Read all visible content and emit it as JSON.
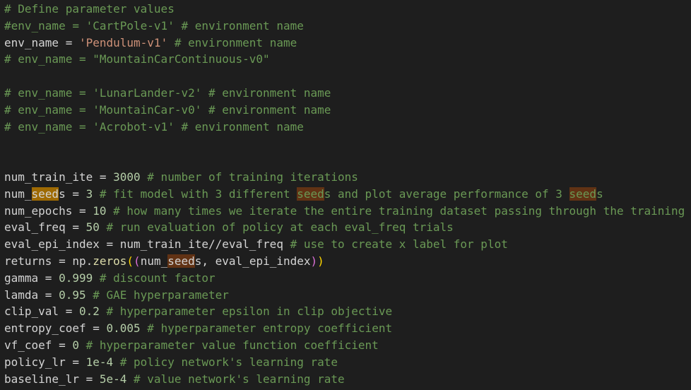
{
  "editor": {
    "lines": [
      [
        {
          "t": "# Define parameter values",
          "c": "comment"
        }
      ],
      [
        {
          "t": "#env_name = 'CartPole-v1' # environment name",
          "c": "comment"
        }
      ],
      [
        {
          "t": "env_name = ",
          "c": "plain"
        },
        {
          "t": "'Pendulum-v1'",
          "c": "string"
        },
        {
          "t": " # environment name",
          "c": "comment"
        }
      ],
      [
        {
          "t": "# env_name = \"MountainCarContinuous-v0\"",
          "c": "comment"
        }
      ],
      [],
      [
        {
          "t": "# env_name = 'LunarLander-v2' # environment name",
          "c": "comment"
        }
      ],
      [
        {
          "t": "# env_name = 'MountainCar-v0' # environment name",
          "c": "comment"
        }
      ],
      [
        {
          "t": "# env_name = 'Acrobot-v1' # environment name",
          "c": "comment"
        }
      ],
      [],
      [],
      [
        {
          "t": "num_train_ite = ",
          "c": "plain"
        },
        {
          "t": "3000",
          "c": "number"
        },
        {
          "t": " # number of training iterations",
          "c": "comment"
        }
      ],
      [
        {
          "t": "num_",
          "c": "plain"
        },
        {
          "t": "seed",
          "c": "plain",
          "h": "main"
        },
        {
          "t": "s = ",
          "c": "plain"
        },
        {
          "t": "3",
          "c": "number"
        },
        {
          "t": " # fit model with 3 different ",
          "c": "comment"
        },
        {
          "t": "seed",
          "c": "comment",
          "h": "other"
        },
        {
          "t": "s and plot average performance of 3 ",
          "c": "comment"
        },
        {
          "t": "seed",
          "c": "comment",
          "h": "other"
        },
        {
          "t": "s",
          "c": "comment"
        }
      ],
      [
        {
          "t": "num_epochs = ",
          "c": "plain"
        },
        {
          "t": "10",
          "c": "number"
        },
        {
          "t": " # how many times we iterate the entire training dataset passing through the training",
          "c": "comment"
        }
      ],
      [
        {
          "t": "eval_freq = ",
          "c": "plain"
        },
        {
          "t": "50",
          "c": "number"
        },
        {
          "t": " # run evaluation of policy at each eval_freq trials",
          "c": "comment"
        }
      ],
      [
        {
          "t": "eval_epi_index = num_train_ite//eval_freq",
          "c": "plain"
        },
        {
          "t": " # use to create x label for plot",
          "c": "comment"
        }
      ],
      [
        {
          "t": "returns = np.",
          "c": "plain"
        },
        {
          "t": "zeros",
          "c": "yellow"
        },
        {
          "t": "(",
          "c": "br1"
        },
        {
          "t": "(",
          "c": "br2"
        },
        {
          "t": "num_",
          "c": "plain"
        },
        {
          "t": "seed",
          "c": "plain",
          "h": "other"
        },
        {
          "t": "s, eval_epi_index",
          "c": "plain"
        },
        {
          "t": ")",
          "c": "br2"
        },
        {
          "t": ")",
          "c": "br1"
        }
      ],
      [
        {
          "t": "gamma = ",
          "c": "plain"
        },
        {
          "t": "0.999",
          "c": "number"
        },
        {
          "t": " # discount factor",
          "c": "comment"
        }
      ],
      [
        {
          "t": "lamda = ",
          "c": "plain"
        },
        {
          "t": "0.95",
          "c": "number"
        },
        {
          "t": " # GAE hyperparameter",
          "c": "comment"
        }
      ],
      [
        {
          "t": "clip_val = ",
          "c": "plain"
        },
        {
          "t": "0.2",
          "c": "number"
        },
        {
          "t": " # hyperparameter epsilon in clip objective",
          "c": "comment"
        }
      ],
      [
        {
          "t": "entropy_coef = ",
          "c": "plain"
        },
        {
          "t": "0.005",
          "c": "number"
        },
        {
          "t": " # hyperparameter entropy coefficient",
          "c": "comment"
        }
      ],
      [
        {
          "t": "vf_coef = ",
          "c": "plain"
        },
        {
          "t": "0",
          "c": "number"
        },
        {
          "t": " # hyperparameter value function coefficient",
          "c": "comment"
        }
      ],
      [
        {
          "t": "policy_lr = ",
          "c": "plain"
        },
        {
          "t": "1e-4",
          "c": "number"
        },
        {
          "t": " # policy network's learning rate",
          "c": "comment"
        }
      ],
      [
        {
          "t": "baseline_lr = ",
          "c": "plain"
        },
        {
          "t": "5e-4",
          "c": "number"
        },
        {
          "t": " # value network's learning rate",
          "c": "comment"
        }
      ]
    ]
  },
  "colors": {
    "background": "#1e1e1e",
    "comment": "#6a9955",
    "string": "#ce9178",
    "number": "#b5cea8",
    "plain": "#d4d4d4",
    "function": "#dcdcaa",
    "bracket_outer": "#ffd700",
    "bracket_inner": "#da70d6",
    "highlight_main": "#9e6a03",
    "highlight_other": "#613214"
  }
}
